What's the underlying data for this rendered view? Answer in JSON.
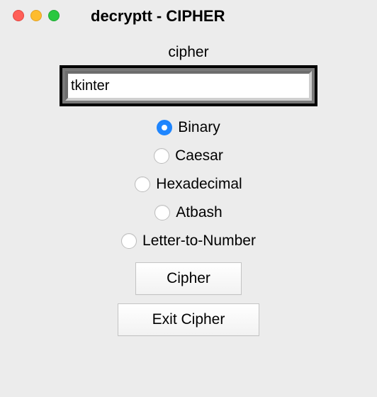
{
  "window": {
    "title": "decryptt - CIPHER"
  },
  "form": {
    "label": "cipher",
    "input_value": "tkinter"
  },
  "radios": {
    "selected_index": 0,
    "options": [
      {
        "label": "Binary"
      },
      {
        "label": "Caesar"
      },
      {
        "label": "Hexadecimal"
      },
      {
        "label": "Atbash"
      },
      {
        "label": "Letter-to-Number"
      }
    ]
  },
  "buttons": {
    "cipher_label": "Cipher",
    "exit_label": "Exit Cipher"
  }
}
